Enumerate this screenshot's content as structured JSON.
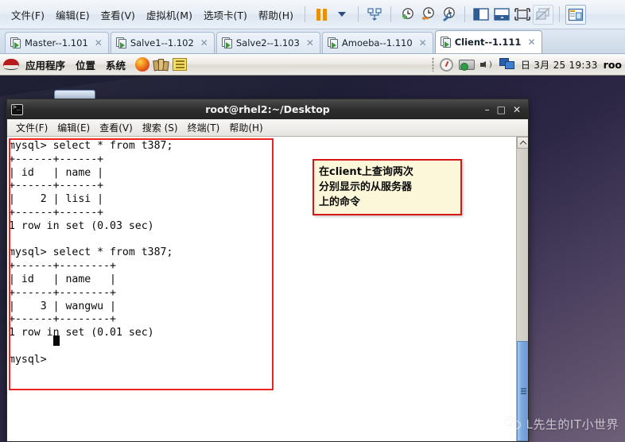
{
  "vmware": {
    "menus": [
      {
        "label": "文件(F)",
        "name": "menu-file"
      },
      {
        "label": "编辑(E)",
        "name": "menu-edit"
      },
      {
        "label": "查看(V)",
        "name": "menu-view"
      },
      {
        "label": "虚拟机(M)",
        "name": "menu-vm"
      },
      {
        "label": "选项卡(T)",
        "name": "menu-tabs"
      },
      {
        "label": "帮助(H)",
        "name": "menu-help"
      }
    ],
    "toolbar": {
      "pause": "pause-icon",
      "pause_dropdown": "chevron-down-icon",
      "snapshot_manager": "snapshot-manager-icon",
      "take_snapshot": "take-snapshot-icon",
      "revert_snapshot": "revert-snapshot-icon",
      "snapshot_settings": "snapshot-settings-icon",
      "show_sidebar": "show-sidebar-icon",
      "show_console": "show-console-icon",
      "fullscreen": "fullscreen-icon",
      "unity_mode": "unity-mode-icon",
      "library": "library-icon"
    },
    "tabs": [
      {
        "label": "Master--1.101",
        "active": false
      },
      {
        "label": "Salve1--1.102",
        "active": false
      },
      {
        "label": "Salve2--1.103",
        "active": false
      },
      {
        "label": "Amoeba--1.110",
        "active": false
      },
      {
        "label": "Client--1.111",
        "active": true
      }
    ],
    "tab_close_glyph": "✕"
  },
  "gnome_panel": {
    "logo": "redhat-logo",
    "menus": [
      {
        "label": "应用程序",
        "name": "panel-menu-applications"
      },
      {
        "label": "位置",
        "name": "panel-menu-places"
      },
      {
        "label": "系统",
        "name": "panel-menu-system"
      }
    ],
    "launchers": [
      {
        "name": "firefox-icon"
      },
      {
        "name": "help-books-icon"
      },
      {
        "name": "notes-icon"
      }
    ],
    "tray": [
      {
        "name": "gauge-icon"
      },
      {
        "name": "network-icon"
      },
      {
        "name": "volume-icon"
      },
      {
        "name": "display-icon"
      }
    ],
    "clock": "日 3月 25 19:33",
    "user": "roo"
  },
  "terminal": {
    "title": "root@rhel2:~/Desktop",
    "window_buttons": {
      "minimize": "–",
      "maximize": "□",
      "close": "✕"
    },
    "menus": [
      {
        "label": "文件(F)",
        "name": "term-menu-file"
      },
      {
        "label": "编辑(E)",
        "name": "term-menu-edit"
      },
      {
        "label": "查看(V)",
        "name": "term-menu-view"
      },
      {
        "label": "搜索 (S)",
        "name": "term-menu-search"
      },
      {
        "label": "终端(T)",
        "name": "term-menu-terminal"
      },
      {
        "label": "帮助(H)",
        "name": "term-menu-help"
      }
    ],
    "content": "mysql> select * from t387;\n+------+------+\n| id   | name |\n+------+------+\n|    2 | lisi |\n+------+------+\n1 row in set (0.03 sec)\n\nmysql> select * from t387;\n+------+--------+\n| id   | name   |\n+------+--------+\n|    3 | wangwu |\n+------+--------+\n1 row in set (0.01 sec)\n\nmysql> ",
    "scrollbar": {
      "up_arrow": "scroll-up-icon"
    }
  },
  "annotation": {
    "text": "在client上查询两次\n分别显示的从服务器\n上的命令",
    "border_color": "#d81616",
    "background_color": "#fbf7d8"
  },
  "highlight": {
    "color": "#ef2222"
  },
  "watermark": {
    "logo": "wechat-icon",
    "text": "L先生的IT小世界"
  }
}
